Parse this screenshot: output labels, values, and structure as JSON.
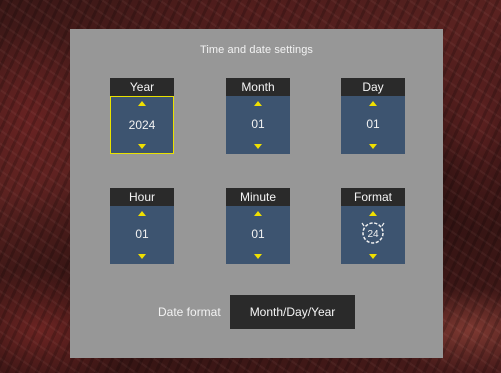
{
  "panel": {
    "title": "Time and date settings"
  },
  "fields": {
    "year": {
      "label": "Year",
      "value": "2024",
      "selected": true
    },
    "month": {
      "label": "Month",
      "value": "01"
    },
    "day": {
      "label": "Day",
      "value": "01"
    },
    "hour": {
      "label": "Hour",
      "value": "01"
    },
    "minute": {
      "label": "Minute",
      "value": "01"
    },
    "format": {
      "label": "Format",
      "value": "24",
      "icon": "clock-24-icon"
    }
  },
  "date_format": {
    "label": "Date format",
    "value": "Month/Day/Year"
  },
  "colors": {
    "panel": "#979797",
    "label_bg": "#2a2a2a",
    "spinner_bg": "#3d5470",
    "accent": "#f0e000"
  }
}
